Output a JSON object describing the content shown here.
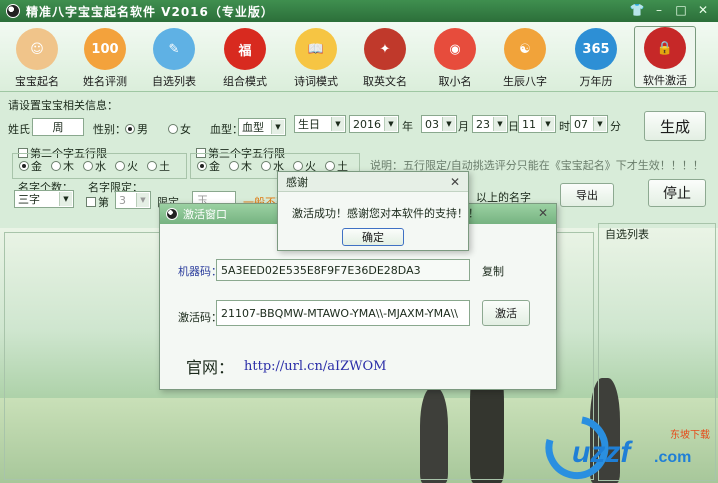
{
  "window": {
    "title": "精准八字宝宝起名软件 V2016（专业版）"
  },
  "toolbar": {
    "items": [
      {
        "label": "宝宝起名",
        "icon": "baby-face-icon",
        "color": "#f0c48a",
        "glyph": "☺"
      },
      {
        "label": "姓名评测",
        "icon": "score-100-icon",
        "color": "#f3a23c",
        "glyph": "100"
      },
      {
        "label": "自选列表",
        "icon": "bird-book-icon",
        "color": "#5fb1e4",
        "glyph": "✎"
      },
      {
        "label": "组合模式",
        "icon": "red-lantern-icon",
        "color": "#d82a1f",
        "glyph": "福"
      },
      {
        "label": "诗词模式",
        "icon": "open-book-icon",
        "color": "#f6c543",
        "glyph": "📖"
      },
      {
        "label": "取英文名",
        "icon": "crest-icon",
        "color": "#c0392b",
        "glyph": "✦"
      },
      {
        "label": "取小名",
        "icon": "monkey-mask-icon",
        "color": "#e74c3c",
        "glyph": "◉"
      },
      {
        "label": "生辰八字",
        "icon": "yin-yang-icon",
        "color": "#f1a33a",
        "glyph": "☯"
      },
      {
        "label": "万年历",
        "icon": "calendar-365-icon",
        "color": "#2d8fd5",
        "glyph": "365"
      },
      {
        "label": "软件激活",
        "icon": "lock-icon",
        "color": "#c62828",
        "glyph": "🔒"
      }
    ]
  },
  "form": {
    "section_label": "请设置宝宝相关信息：",
    "surname_label": "姓氏：",
    "surname_value": "周",
    "gender_label": "性别：",
    "gender_male": "男",
    "gender_female": "女",
    "blood_label": "血型：",
    "blood_value": "血型",
    "birthday_value": "生日",
    "year_value": "2016",
    "year_unit": "年",
    "month_value": "03",
    "month_unit": "月",
    "day_value": "23",
    "day_unit": "日",
    "hour_value": "11",
    "hour_unit": "时",
    "minute_value": "07",
    "minute_unit": "分",
    "generate_button": "生成",
    "stop_button": "停止",
    "export_button": "导出",
    "second_char_wuxing": "第二个字五行限",
    "third_char_wuxing": "第三个字五行限",
    "wuxing": [
      "金",
      "木",
      "水",
      "火",
      "土"
    ],
    "note": "说明：五行限定/自动挑选评分只能在《宝宝起名》下才生效！！！！",
    "name_count_label": "名字个数：",
    "name_count_value": "三字",
    "name_limit_label": "名字限定：",
    "limit_position_label": "第",
    "limit_position_value": "3",
    "limit_label": "限定",
    "limit_char_value": "玉",
    "limit_warning": "一般不建",
    "above_name_text": "以上的名字"
  },
  "right_panel": {
    "caption": "自选列表"
  },
  "activation_dialog": {
    "title": "激活窗口",
    "machine_code_label": "机器码：",
    "machine_code_value": "5A3EED02E535E8F9F7E36DE28DA3",
    "copy_link": "复制",
    "activation_code_label": "激活码：",
    "activation_code_value": "21107-BBQMW-MTAWO-YMA\\\\-MJAXM-YMA\\\\",
    "activate_button": "激活",
    "website_label": "官网：",
    "website_url": "http://url.cn/aIZWOM"
  },
  "thanks_dialog": {
    "title": "感谢",
    "message": "激活成功！感谢您对本软件的支持！！",
    "ok_button": "确定"
  },
  "watermark": {
    "brand": "uzzf.com",
    "sub": "东坡下载"
  }
}
